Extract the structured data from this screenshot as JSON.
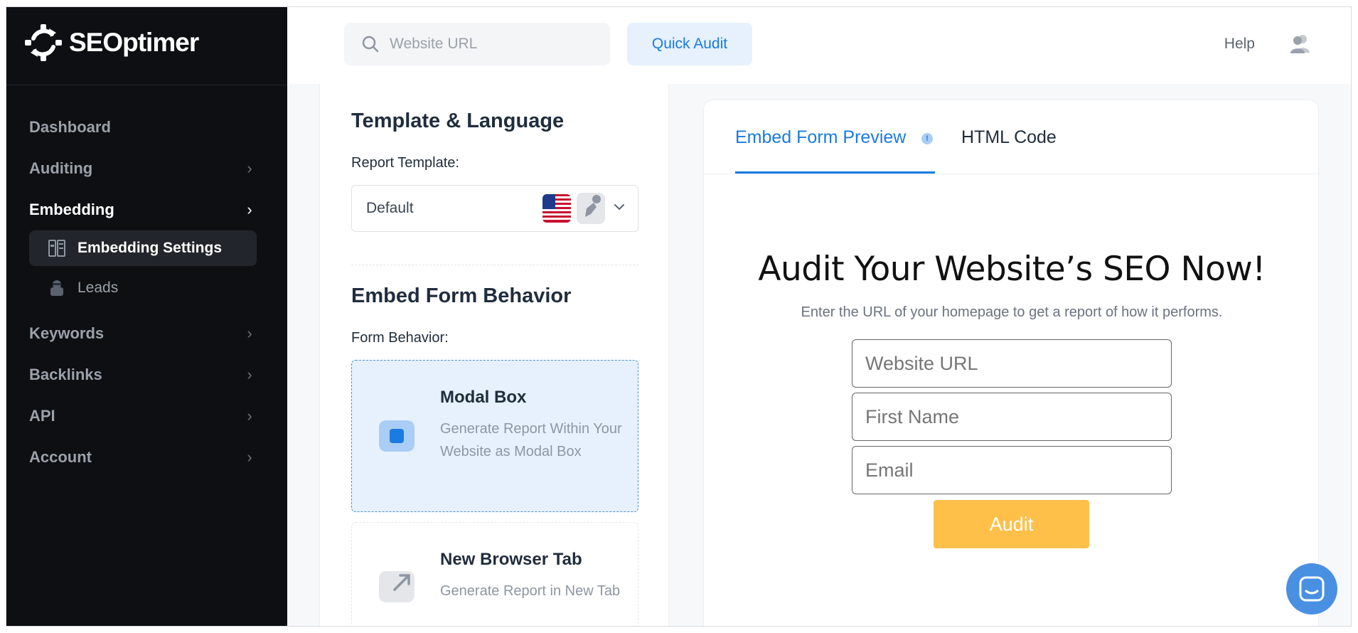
{
  "brand": {
    "name": "SEOptimer"
  },
  "sidebar": {
    "items": [
      {
        "label": "Dashboard",
        "chevron": false
      },
      {
        "label": "Auditing",
        "chevron": true
      },
      {
        "label": "Embedding",
        "chevron": true,
        "active": true
      },
      {
        "label": "Keywords",
        "chevron": true
      },
      {
        "label": "Backlinks",
        "chevron": true
      },
      {
        "label": "API",
        "chevron": true
      },
      {
        "label": "Account",
        "chevron": true
      }
    ],
    "sub_items": [
      {
        "label": "Embedding Settings",
        "icon": "embed-settings-icon",
        "active": true
      },
      {
        "label": "Leads",
        "icon": "leads-icon"
      }
    ]
  },
  "topbar": {
    "search_placeholder": "Website URL",
    "quick_audit_label": "Quick Audit",
    "help_label": "Help"
  },
  "settings": {
    "template_section_title": "Template & Language",
    "report_template_label": "Report Template:",
    "report_template_value": "Default",
    "behavior_section_title": "Embed Form Behavior",
    "form_behavior_label": "Form Behavior:",
    "options": [
      {
        "title": "Modal Box",
        "desc": "Generate Report Within Your Website as Modal Box",
        "selected": true
      },
      {
        "title": "New Browser Tab",
        "desc": "Generate Report in New Tab",
        "selected": false
      }
    ]
  },
  "preview": {
    "tabs": [
      {
        "label": "Embed Form Preview",
        "active": true
      },
      {
        "label": "HTML Code",
        "active": false
      }
    ],
    "info_badge": "!",
    "form_title": "Audit Your Website’s SEO Now!",
    "form_subtitle": "Enter the URL of your homepage to get a report of how it performs.",
    "fields": [
      {
        "placeholder": "Website URL"
      },
      {
        "placeholder": "First Name"
      },
      {
        "placeholder": "Email"
      }
    ],
    "submit_label": "Audit"
  },
  "colors": {
    "sidebar_bg": "#0d0f12",
    "accent": "#1a7be0",
    "audit_button": "#ffc04a",
    "selected_option_bg": "#e6f1fd"
  }
}
